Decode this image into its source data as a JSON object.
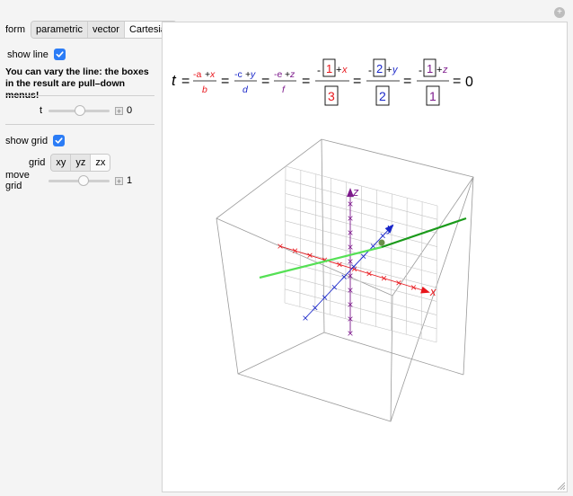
{
  "form": {
    "label": "form",
    "options": [
      "parametric",
      "vector",
      "Cartesian"
    ],
    "selected": "Cartesian"
  },
  "show_line": {
    "label": "show line",
    "checked": true
  },
  "note": "You can vary the line: the boxes in the result are pull–down menus!",
  "t_slider": {
    "label": "t",
    "value": "0",
    "fraction": 0.5
  },
  "show_grid": {
    "label": "show grid",
    "checked": true
  },
  "grid": {
    "label": "grid",
    "options": [
      "xy",
      "yz",
      "zx"
    ],
    "selected": "zx"
  },
  "move_grid": {
    "label": "move grid",
    "value": "1",
    "fraction": 0.55
  },
  "equation": {
    "t": "t",
    "eq": "=",
    "neg": "-",
    "x_term": {
      "a": "-a",
      "plus": "+",
      "x": "x",
      "den": "b"
    },
    "y_term": {
      "c": "-c",
      "plus": "+",
      "y": "y",
      "den": "d"
    },
    "z_term": {
      "e": "-e",
      "plus": "+",
      "z": "z",
      "den": "f"
    },
    "num_boxes": [
      "1",
      "2",
      "1"
    ],
    "den_boxes": [
      "3",
      "2",
      "1"
    ],
    "zero": "0"
  },
  "axes": {
    "x": "x",
    "y": "y",
    "z": "z"
  },
  "colors": {
    "x": "#e8161c",
    "y": "#1a27c9",
    "z": "#7d1a8c",
    "line_dark": "#1a9a1a",
    "line_light": "#55e055",
    "accent": "#2b7cf6"
  }
}
